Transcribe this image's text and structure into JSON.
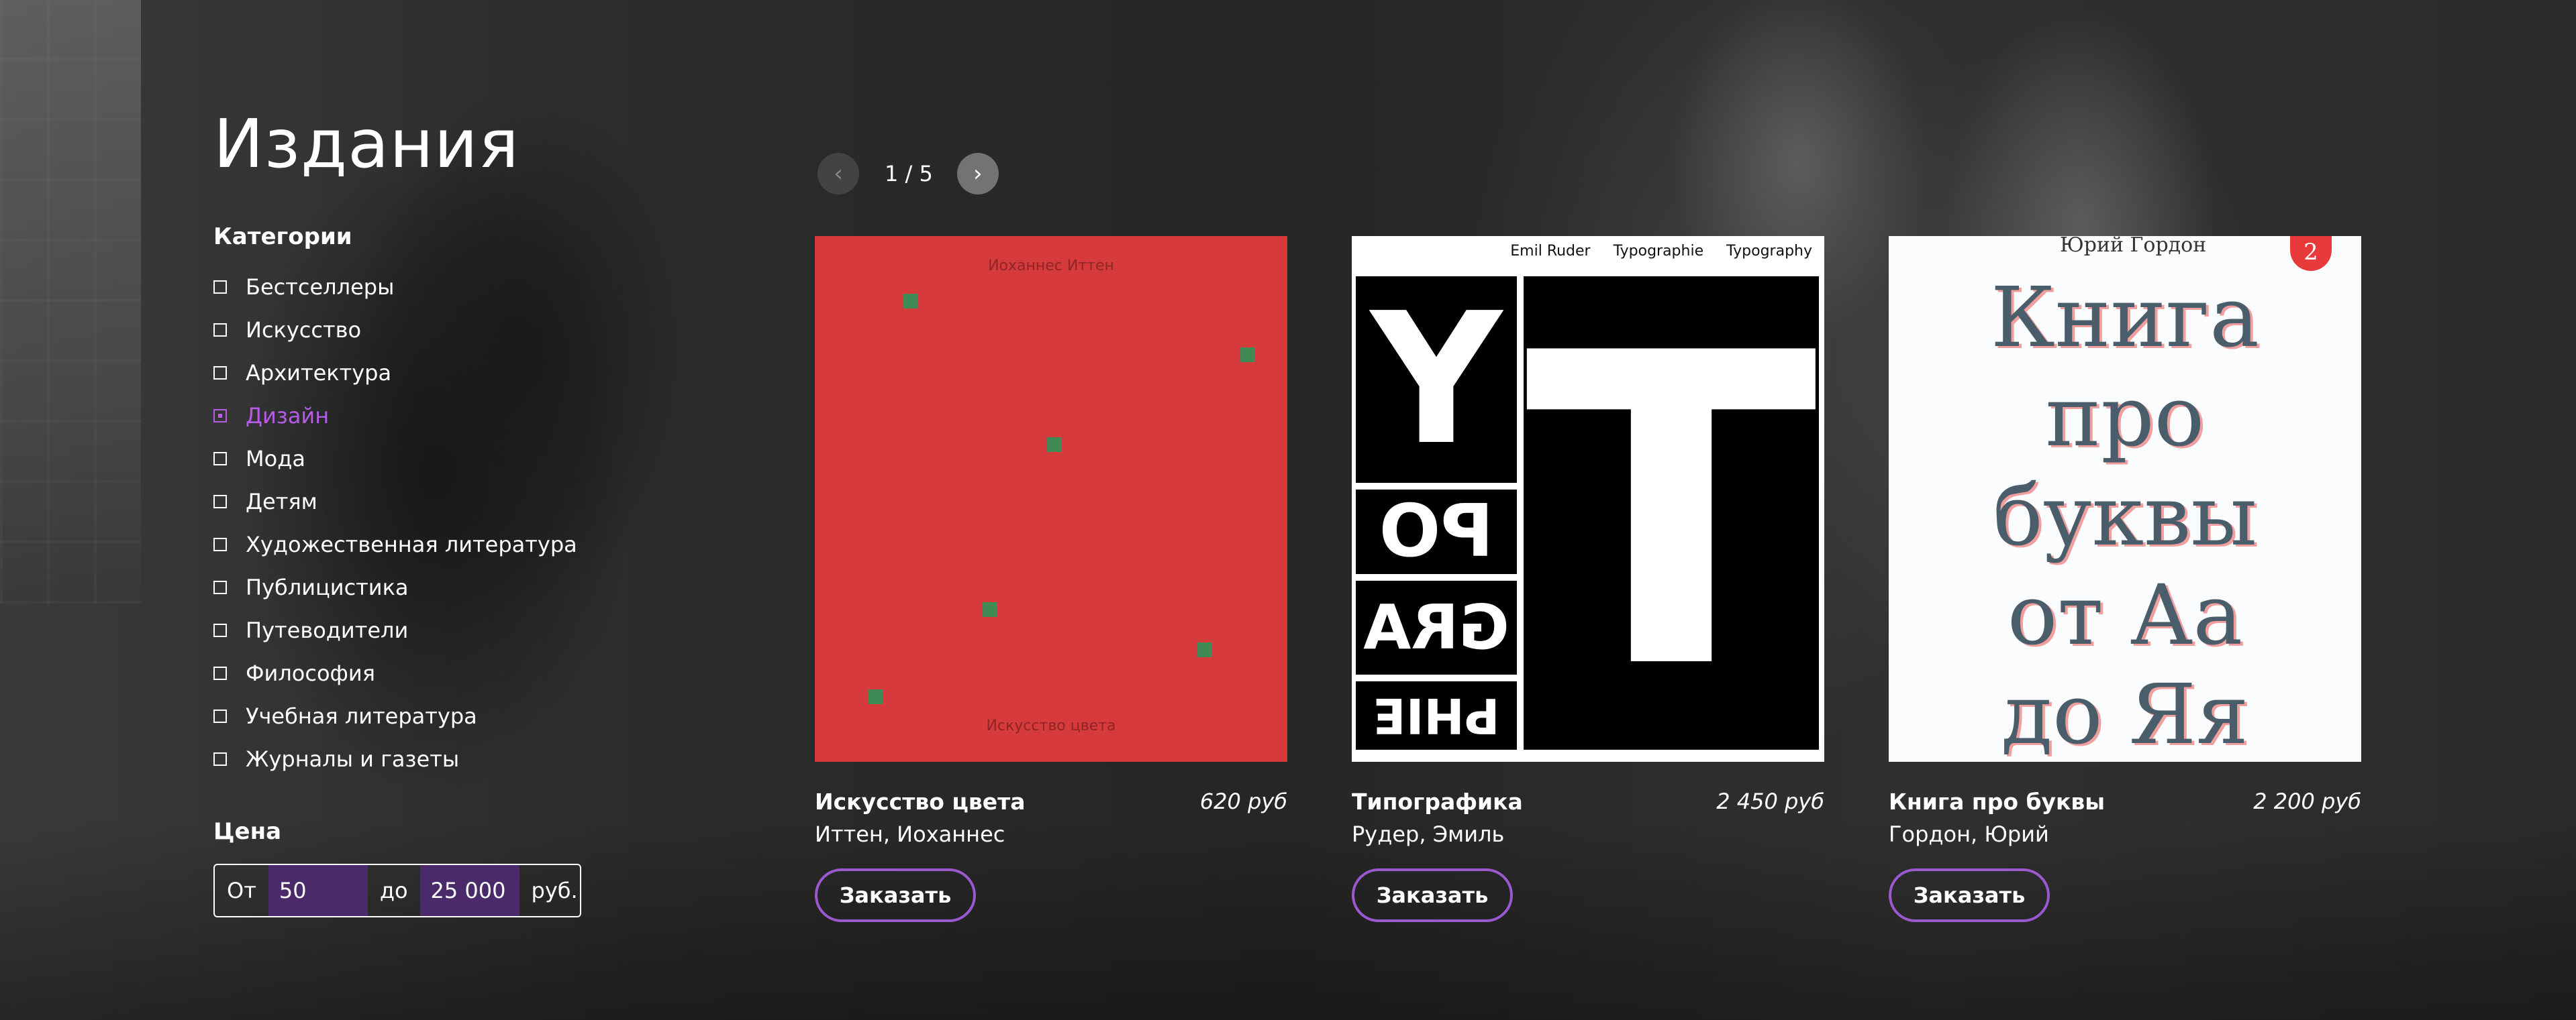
{
  "page": {
    "title": "Издания"
  },
  "categories": {
    "label": "Категории",
    "items": [
      {
        "label": "Бестселлеры",
        "active": false
      },
      {
        "label": "Искусство",
        "active": false
      },
      {
        "label": "Архитектура",
        "active": false
      },
      {
        "label": "Дизайн",
        "active": true
      },
      {
        "label": "Мода",
        "active": false
      },
      {
        "label": "Детям",
        "active": false
      },
      {
        "label": "Художественная литература",
        "active": false
      },
      {
        "label": "Публицистика",
        "active": false
      },
      {
        "label": "Путеводители",
        "active": false
      },
      {
        "label": "Философия",
        "active": false
      },
      {
        "label": "Учебная литература",
        "active": false
      },
      {
        "label": "Журналы и газеты",
        "active": false
      }
    ]
  },
  "price": {
    "label": "Цена",
    "from_label": "От",
    "from_value": "50",
    "to_label": "до",
    "to_value": "25 000",
    "unit": "руб."
  },
  "pager": {
    "text": "1 / 5",
    "prev_icon": "chevron-left-icon",
    "next_icon": "chevron-right-icon"
  },
  "products": [
    {
      "title": "Искусство цвета",
      "price": "620 руб",
      "author": "Иттен, Иоханнес",
      "order_label": "Заказать",
      "cover": {
        "top_text": "Иоханнес Иттен",
        "bottom_text": "Искусство цвета",
        "bg": "#d63a3c"
      }
    },
    {
      "title": "Типографика",
      "price": "2 450 руб",
      "author": "Рудер, Эмиль",
      "order_label": "Заказать",
      "cover": {
        "header": [
          "Emil Ruder",
          "Typographie",
          "Typography"
        ],
        "letters": [
          "Y",
          "T",
          "PO",
          "GRA",
          "PHIE"
        ]
      }
    },
    {
      "title": "Книга про буквы",
      "price": "2 200 руб",
      "author": "Гордон, Юрий",
      "order_label": "Заказать",
      "cover": {
        "author": "Юрий Гордон",
        "badge": "2",
        "lines": [
          "Книга",
          "про",
          "буквы",
          "от Аа",
          "до Яя"
        ]
      }
    }
  ],
  "colors": {
    "accent": "#b65be6",
    "button_border": "#9b59d0",
    "input_bg": "#4a2a6b"
  }
}
